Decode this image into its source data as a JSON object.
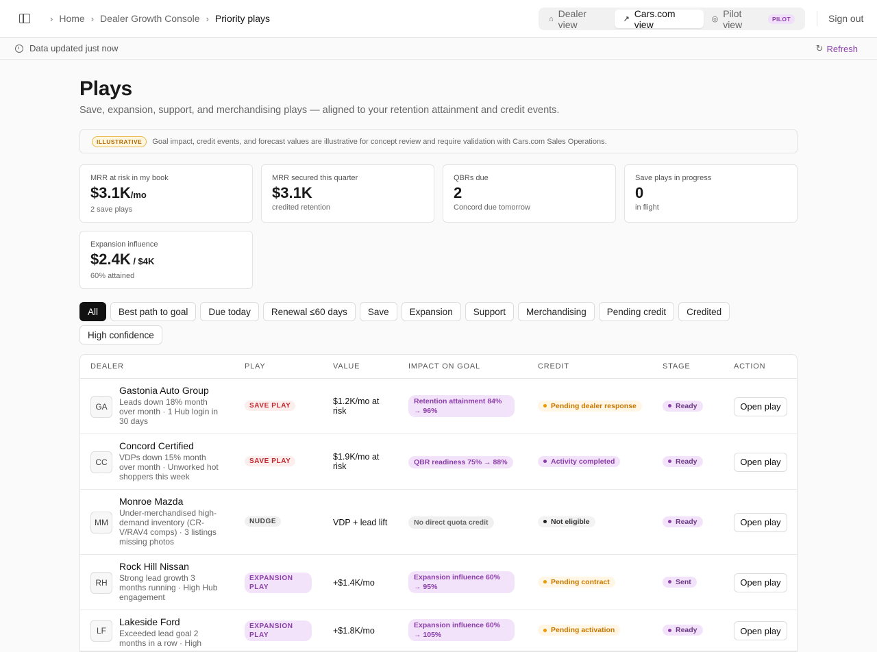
{
  "breadcrumb": [
    "Home",
    "Dealer Growth Console",
    "Priority plays"
  ],
  "views": [
    {
      "label": "Dealer view",
      "icon": "home-icon"
    },
    {
      "label": "Cars.com view",
      "icon": "trend-up-icon"
    },
    {
      "label": "Pilot view",
      "icon": "target-icon",
      "badge": "PILOT"
    }
  ],
  "active_view": "Cars.com view",
  "signout_label": "Sign out",
  "status": {
    "text": "Data updated just now",
    "refresh_label": "Refresh"
  },
  "page": {
    "title": "Plays",
    "subtitle": "Save, expansion, support, and merchandising plays — aligned to your retention attainment and credit events."
  },
  "notice": {
    "badge": "ILLUSTRATIVE",
    "text": "Goal impact, credit events, and forecast values are illustrative for concept review and require validation with Cars.com Sales Operations."
  },
  "cards": [
    {
      "label": "MRR at risk in my book",
      "value": "$3.1K",
      "unit": "/mo",
      "sub": "2 save plays"
    },
    {
      "label": "MRR secured this quarter",
      "value": "$3.1K",
      "unit": "",
      "sub": "credited retention"
    },
    {
      "label": "QBRs due",
      "value": "2",
      "unit": "",
      "sub": "Concord due tomorrow"
    },
    {
      "label": "Save plays in progress",
      "value": "0",
      "unit": "",
      "sub": "in flight"
    },
    {
      "label": "Expansion influence",
      "value": "$2.4K",
      "unit": " / $4K",
      "sub": "60% attained"
    }
  ],
  "filters": [
    "All",
    "Best path to goal",
    "Due today",
    "Renewal ≤60 days",
    "Save",
    "Expansion",
    "Support",
    "Merchandising",
    "Pending credit",
    "Credited",
    "High confidence"
  ],
  "active_filter": "All",
  "table": {
    "headers": [
      "DEALER",
      "PLAY",
      "VALUE",
      "IMPACT ON GOAL",
      "CREDIT",
      "STAGE",
      "ACTION"
    ],
    "rows": [
      {
        "initials": "GA",
        "name": "Gastonia Auto Group",
        "desc": "Leads down 18% month over month · 1 Hub login in 30 days",
        "play": "SAVE PLAY",
        "play_kind": "save",
        "value": "$1.2K/mo at risk",
        "impact": "Retention attainment 84% → 96%",
        "impact_kind": "p",
        "credit": "Pending dealer response",
        "credit_kind": "pending",
        "stage": "Ready",
        "action": "Open play"
      },
      {
        "initials": "CC",
        "name": "Concord Certified",
        "desc": "VDPs down 15% month over month · Unworked hot shoppers this week",
        "play": "SAVE PLAY",
        "play_kind": "save",
        "value": "$1.9K/mo at risk",
        "impact": "QBR readiness 75% → 88%",
        "impact_kind": "p",
        "credit": "Activity completed",
        "credit_kind": "done",
        "stage": "Ready",
        "action": "Open play"
      },
      {
        "initials": "MM",
        "name": "Monroe Mazda",
        "desc": "Under-merchandised high-demand inventory (CR-V/RAV4 comps) · 3 listings missing photos",
        "play": "NUDGE",
        "play_kind": "nudge",
        "value": "VDP + lead lift",
        "impact": "No direct quota credit",
        "impact_kind": "g",
        "credit": "Not eligible",
        "credit_kind": "none",
        "stage": "Ready",
        "action": "Open play"
      },
      {
        "initials": "RH",
        "name": "Rock Hill Nissan",
        "desc": "Strong lead growth 3 months running · High Hub engagement",
        "play": "EXPANSION PLAY",
        "play_kind": "exp",
        "value": "+$1.4K/mo",
        "impact": "Expansion influence 60% → 95%",
        "impact_kind": "p",
        "credit": "Pending contract",
        "credit_kind": "pending",
        "stage": "Sent",
        "action": "Open play"
      },
      {
        "initials": "LF",
        "name": "Lakeside Ford",
        "desc": "Exceeded lead goal 2 months in a row · High",
        "play": "EXPANSION PLAY",
        "play_kind": "exp",
        "value": "+$1.8K/mo",
        "impact": "Expansion influence 60% → 105%",
        "impact_kind": "p",
        "credit": "Pending activation",
        "credit_kind": "pending",
        "stage": "Ready",
        "action": "Open play"
      }
    ]
  }
}
